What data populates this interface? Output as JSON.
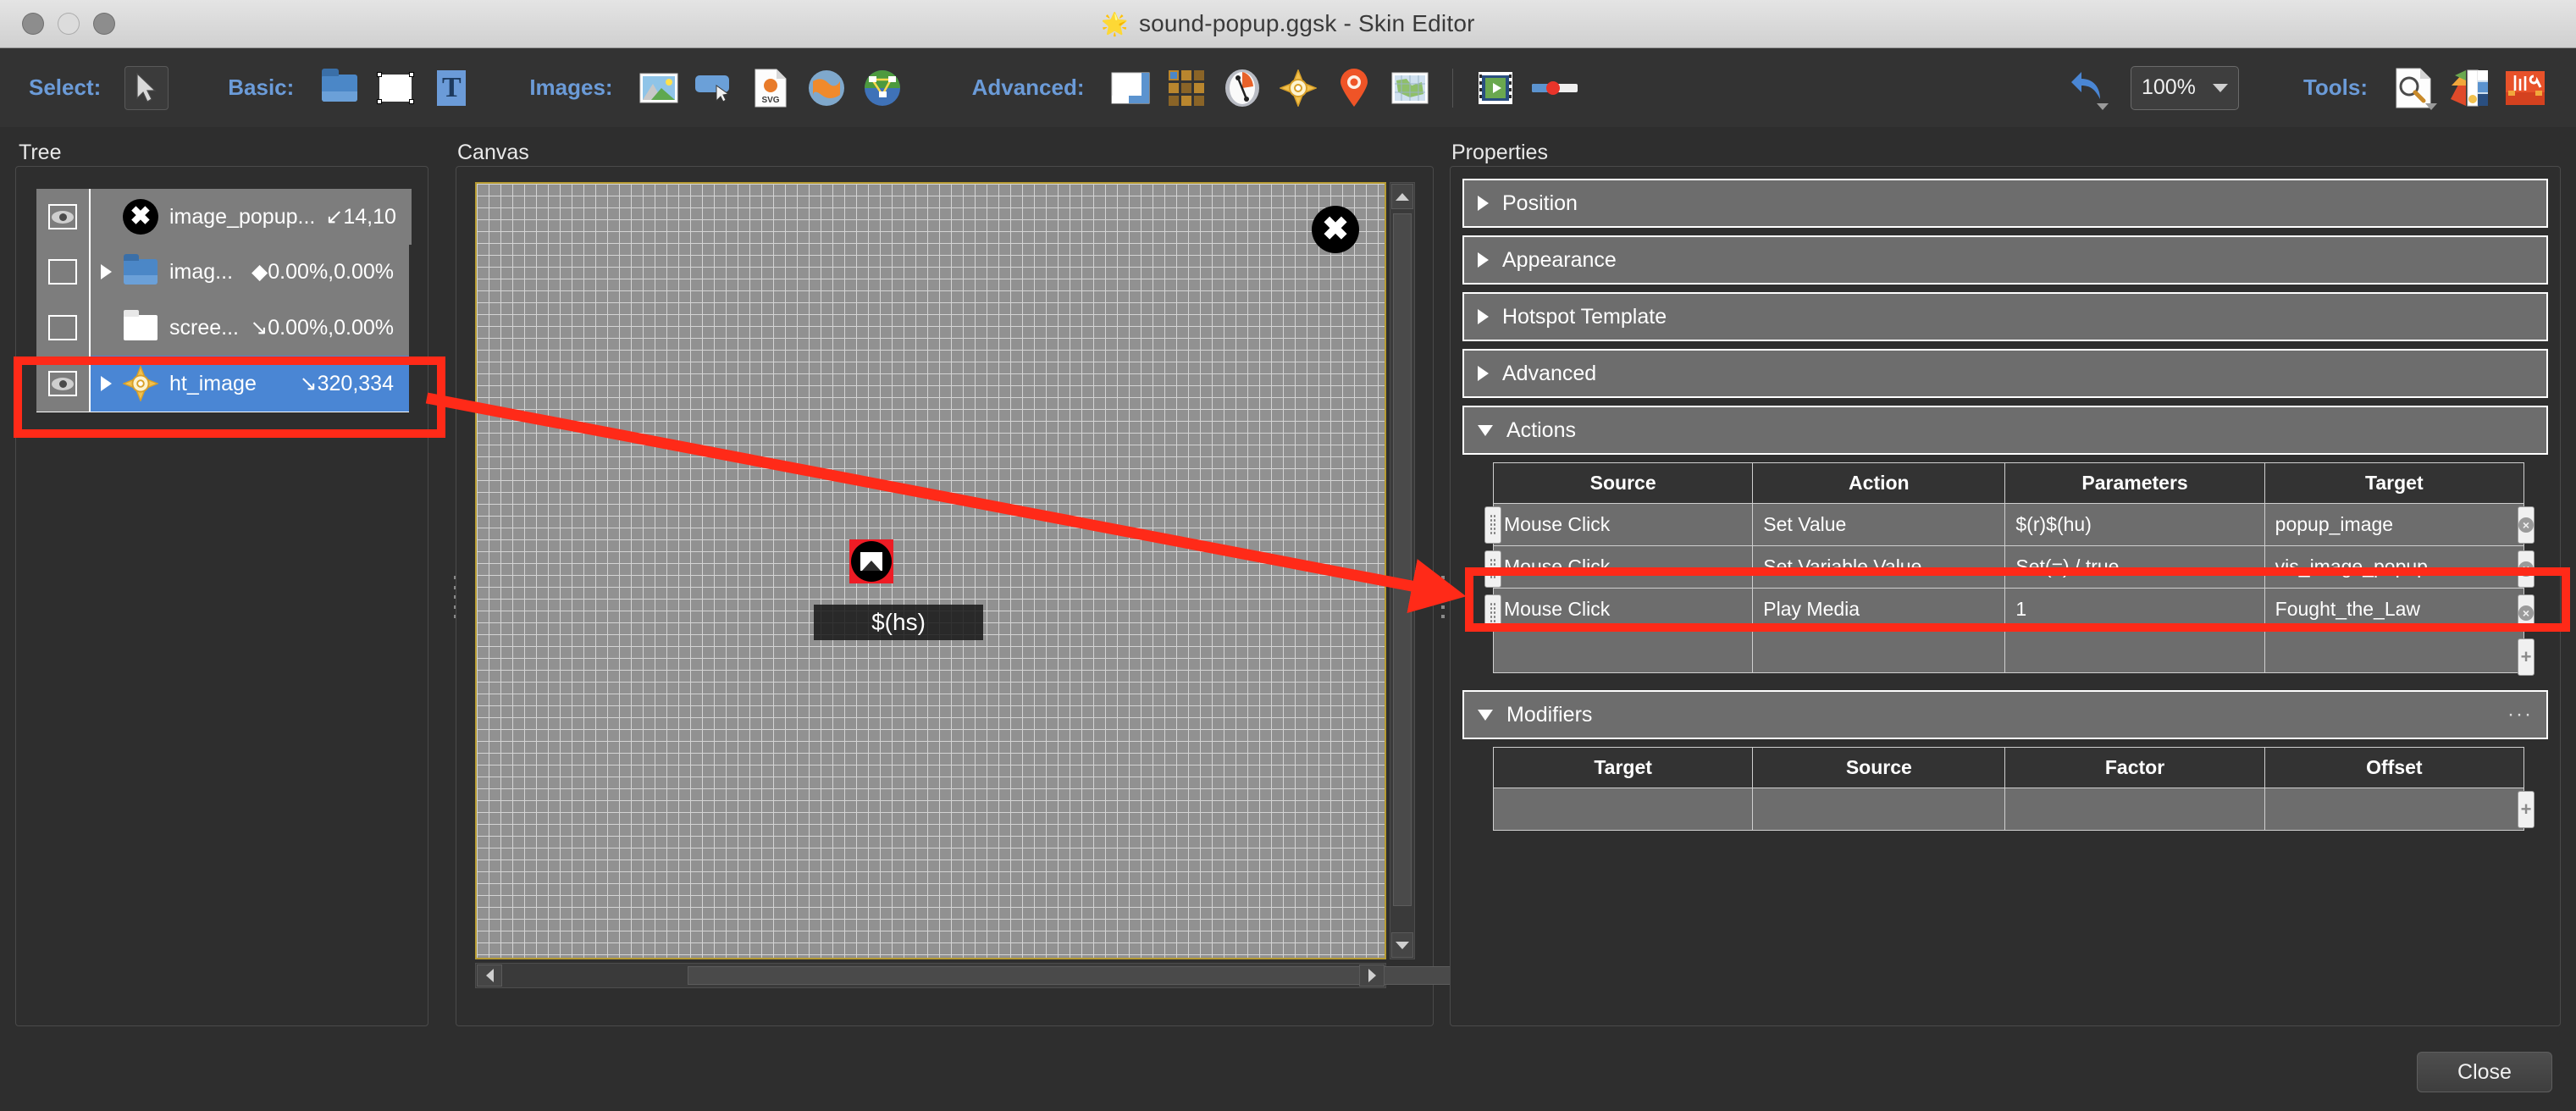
{
  "window": {
    "title": "sound-popup.ggsk - Skin Editor",
    "title_icon": "skin-editor-icon",
    "controls": [
      "close",
      "minimize",
      "maximize"
    ]
  },
  "toolbar": {
    "select_label": "Select:",
    "basic_label": "Basic:",
    "images_label": "Images:",
    "advanced_label": "Advanced:",
    "tools_label": "Tools:",
    "zoom_value": "100%",
    "buttons": {
      "select_arrow": "cursor-arrow-icon",
      "basic_container": "folder-icon",
      "basic_rectangle": "rectangle-icon",
      "basic_text": "text-icon",
      "images_image": "picture-icon",
      "images_button": "button-icon",
      "images_svg": "svg-file-icon",
      "images_globe": "globe-icon",
      "images_area": "area-icon",
      "advanced_window": "window-icon",
      "advanced_grid": "thumbnail-grid-icon",
      "advanced_compass": "compass-icon",
      "advanced_radar": "radar-icon",
      "advanced_map_pin": "map-pin-icon",
      "advanced_map": "map-icon",
      "advanced_video": "video-icon",
      "advanced_slider": "slider-icon",
      "undo": "undo-icon",
      "tools_inspect": "magnifier-document-icon",
      "tools_palette": "color-palette-icon",
      "tools_toolbox": "toolbox-icon"
    }
  },
  "panels": {
    "tree_title": "Tree",
    "canvas_title": "Canvas",
    "properties_title": "Properties"
  },
  "tree": {
    "items": [
      {
        "name": "image_popup...",
        "coord": "14,10",
        "coord_glyph": "↙",
        "icon": "close-circle-icon",
        "visible": true,
        "has_children": false,
        "selected": false
      },
      {
        "name": "imag...",
        "coord": "0.00%,0.00%",
        "coord_glyph": "◆",
        "icon": "folder-icon",
        "visible": false,
        "has_children": true,
        "selected": false
      },
      {
        "name": "scree...",
        "coord": "0.00%,0.00%",
        "coord_glyph": "↘",
        "icon": "white-folder-icon",
        "visible": false,
        "has_children": false,
        "selected": false
      },
      {
        "name": "ht_image",
        "coord": "320,334",
        "coord_glyph": "↘",
        "icon": "hotspot-target-icon",
        "visible": true,
        "has_children": true,
        "selected": true
      }
    ]
  },
  "canvas": {
    "close_glyph": "✖",
    "hotspot_label": "$(hs)",
    "hotspot_icon": "image-hotspot-icon",
    "zoom": "100%"
  },
  "properties": {
    "sections": [
      {
        "label": "Position",
        "expanded": false
      },
      {
        "label": "Appearance",
        "expanded": false
      },
      {
        "label": "Hotspot Template",
        "expanded": false
      },
      {
        "label": "Advanced",
        "expanded": false
      },
      {
        "label": "Actions",
        "expanded": true
      },
      {
        "label": "Modifiers",
        "expanded": true,
        "overflow": "···"
      }
    ],
    "actions": {
      "columns": [
        "Source",
        "Action",
        "Parameters",
        "Target"
      ],
      "rows": [
        {
          "source": "Mouse Click",
          "action": "Set Value",
          "parameters": "$(r)$(hu)",
          "target": "popup_image",
          "highlighted": false
        },
        {
          "source": "Mouse Click",
          "action": "Set Variable Value",
          "parameters": "Set(=) / true",
          "target": "vis_image_popup",
          "highlighted": false
        },
        {
          "source": "Mouse Click",
          "action": "Play Media",
          "parameters": "1",
          "target": "Fought_the_Law",
          "highlighted": true
        },
        {
          "source": "",
          "action": "",
          "parameters": "",
          "target": "",
          "highlighted": false
        }
      ],
      "add_glyph": "+",
      "delete_glyph": "×"
    },
    "modifiers": {
      "columns": [
        "Target",
        "Source",
        "Factor",
        "Offset"
      ],
      "rows": [
        {
          "target": "",
          "source": "",
          "factor": "",
          "offset": ""
        }
      ],
      "add_glyph": "+"
    }
  },
  "footer": {
    "close_label": "Close"
  },
  "annotations": {
    "highlight_color": "#ff2a18",
    "boxes": [
      "tree-selected-item",
      "actions-play-media-row"
    ],
    "arrow": "tree-item-to-actions-row"
  }
}
